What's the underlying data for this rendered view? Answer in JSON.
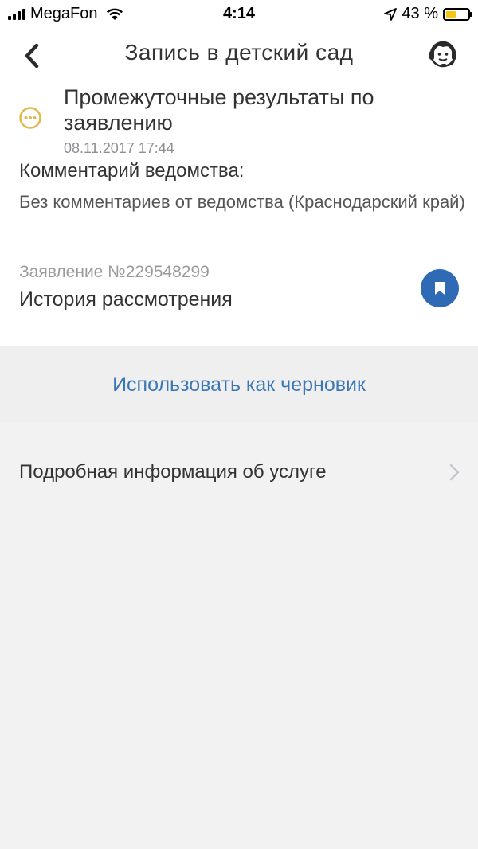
{
  "status_bar": {
    "carrier": "MegaFon",
    "time": "4:14",
    "battery": "43 %",
    "battery_level": 0.43,
    "icons": [
      "signal-icon",
      "wifi-icon",
      "location-icon",
      "battery-icon"
    ]
  },
  "nav": {
    "title": "Запись в детский сад",
    "icons": [
      "back-arrow-icon",
      "support-operator-icon"
    ]
  },
  "result": {
    "title": "Промежуточные результаты по заявлению",
    "date": "08.11.2017 17:44",
    "status_icon": "ellipsis-circle-icon",
    "status_color": "#e5b84c"
  },
  "comment": {
    "label": "Комментарий ведомства:",
    "text": "Без комментариев от ведомства (Краснодарский край)"
  },
  "application": {
    "number": "Заявление №229548299",
    "history_label": "История рассмотрения",
    "bookmark_icon": "bookmark-icon",
    "accent_color": "#2f6bb5"
  },
  "draft": {
    "label": "Использовать как черновик",
    "link_color": "#3b77b6"
  },
  "info": {
    "label": "Подробная информация об услуге",
    "icon": "chevron-right-icon"
  }
}
